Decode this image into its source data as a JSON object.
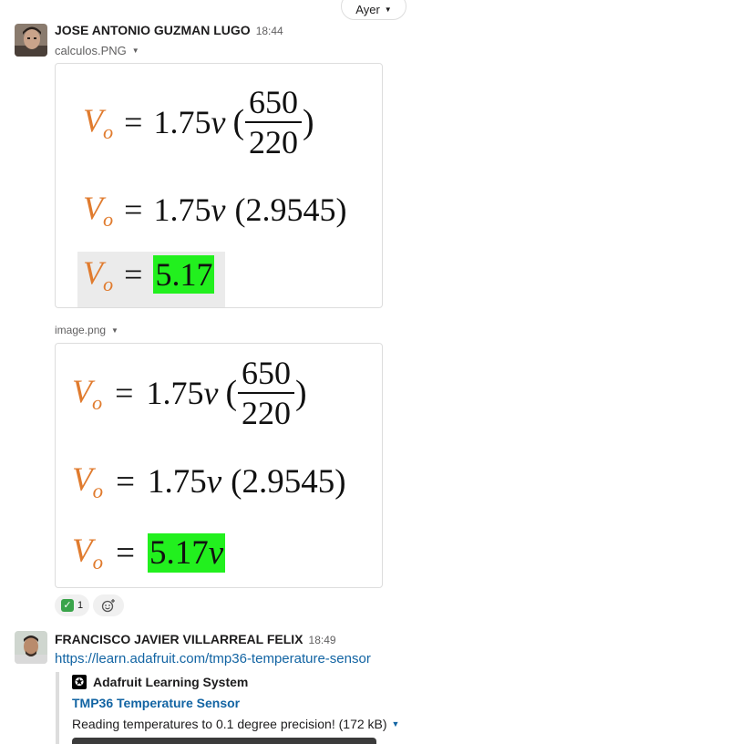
{
  "day_divider": {
    "label": "Ayer"
  },
  "messages": [
    {
      "sender": "JOSE ANTONIO GUZMAN LUGO",
      "time": "18:44",
      "files": [
        {
          "name": "calculos.PNG",
          "lines": [
            {
              "lhs": "V",
              "sub": "o",
              "eq": "=",
              "coef": "1.75",
              "unit": "v",
              "num": "650",
              "den": "220"
            },
            {
              "lhs": "V",
              "sub": "o",
              "eq": "=",
              "coef": "1.75",
              "unit": "v",
              "paren": "(2.9545)"
            },
            {
              "lhs": "V",
              "sub": "o",
              "eq": "=",
              "result": "5.17"
            }
          ]
        },
        {
          "name": "image.png",
          "lines": [
            {
              "lhs": "V",
              "sub": "o",
              "eq": "=",
              "coef": "1.75",
              "unit": "v",
              "num": "650",
              "den": "220"
            },
            {
              "lhs": "V",
              "sub": "o",
              "eq": "=",
              "coef": "1.75",
              "unit": "v",
              "paren": "(2.9545)"
            },
            {
              "lhs": "V",
              "sub": "o",
              "eq": "=",
              "result": "5.17",
              "result_unit": "v"
            }
          ]
        }
      ],
      "reactions": [
        {
          "emoji": "white-check-mark",
          "count": "1"
        }
      ]
    },
    {
      "sender": "FRANCISCO JAVIER VILLARREAL FELIX",
      "time": "18:49",
      "link": "https://learn.adafruit.com/tmp36-temperature-sensor",
      "unfurl": {
        "site": "Adafruit Learning System",
        "title": "TMP36 Temperature Sensor",
        "description": "Reading temperatures to 0.1 degree precision! (172 kB)"
      }
    }
  ],
  "colors": {
    "accent_link": "#1264a3",
    "highlight": "#22f01e",
    "variable": "#e07b2e"
  }
}
